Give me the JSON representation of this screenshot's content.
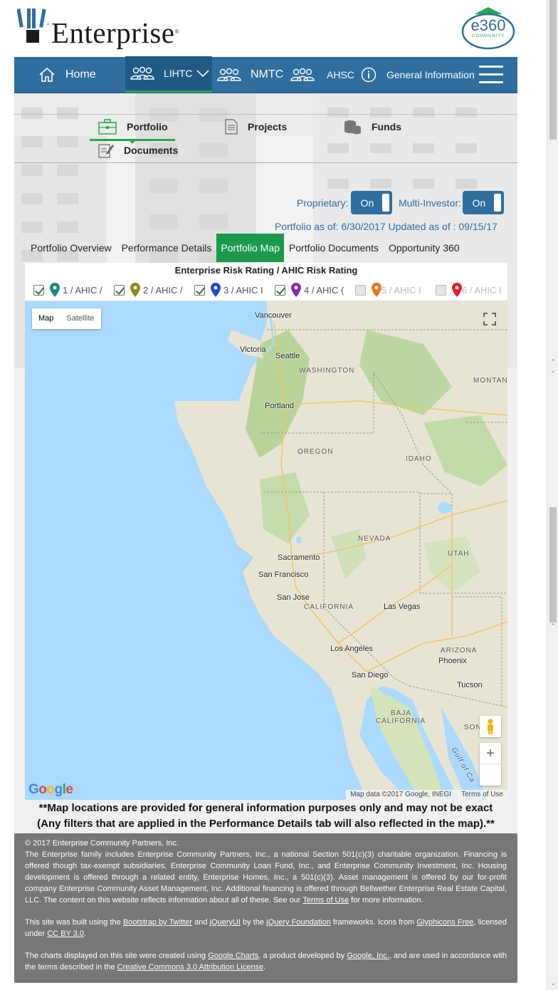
{
  "header": {
    "logo_text": "Enterprise",
    "e360_text": "e360",
    "e360_sub": "COMMUNITY"
  },
  "nav": {
    "items": [
      {
        "label": "Home",
        "icon": "home-icon"
      },
      {
        "label": "LIHTC",
        "icon": "people-icon"
      },
      {
        "label": "NMTC",
        "icon": "people-icon"
      },
      {
        "label": "AHSC",
        "icon": "people-icon"
      },
      {
        "label": "General Information",
        "icon": "info-icon"
      }
    ]
  },
  "subtabs": [
    {
      "label": "Portfolio",
      "icon": "briefcase-icon"
    },
    {
      "label": "Projects",
      "icon": "document-icon"
    },
    {
      "label": "Funds",
      "icon": "coins-icon"
    },
    {
      "label": "Documents",
      "icon": "edit-icon"
    }
  ],
  "toggles": {
    "proprietary_label": "Proprietary:",
    "proprietary_value": "On",
    "multi_label": "Multi-Investor:",
    "multi_value": "On"
  },
  "as_of": "Portfolio as of: 6/30/2017 Updated as of : 09/15/17",
  "main_tabs": [
    "Portfolio Overview",
    "Performance Details",
    "Portfolio Map",
    "Portfolio Documents",
    "Opportunity 360"
  ],
  "map_panel": {
    "title": "Enterprise Risk Rating / AHIC Risk Rating",
    "legend": [
      {
        "label": "1 / AHIC /",
        "color": "#1a8a7a",
        "checked": true
      },
      {
        "label": "2 / AHIC /",
        "color": "#8a8a1a",
        "checked": true
      },
      {
        "label": "3 / AHIC I",
        "color": "#1a4ad0",
        "checked": true
      },
      {
        "label": "4 / AHIC (",
        "color": "#8a2ab0",
        "checked": true
      },
      {
        "label": "5 / AHIC I",
        "color": "#f07020",
        "checked": false
      },
      {
        "label": "6 / AHIC I",
        "color": "#e02020",
        "checked": false
      }
    ],
    "map_type": [
      "Map",
      "Satellite"
    ],
    "attribution": "Map data ©2017 Google, INEGI",
    "terms": "Terms of Use",
    "google": "Google",
    "cities": [
      "Vancouver",
      "Victoria",
      "Seattle",
      "Portland",
      "Sacramento",
      "San Francisco",
      "San Jose",
      "Las Vegas",
      "Los Angeles",
      "San Diego",
      "Phoenix",
      "Tucson"
    ],
    "states": [
      "WASHINGTON",
      "MONTAN",
      "OREGON",
      "IDAHO",
      "NEVADA",
      "UTAH",
      "CALIFORNIA",
      "ARIZONA",
      "BAJA",
      "CALIFORNIA",
      "SON",
      "Gulf of Ca"
    ]
  },
  "note_line1": "**Map locations are provided for general information purposes only and may not be exact",
  "note_line2": "(Any filters that are applied in the Performance Details tab will also reflected in the map).**",
  "footer": {
    "copyright": "© 2017 Enterprise Community Partners, Inc.",
    "p1": "The Enterprise family includes Enterprise Community Partners, Inc., a national Section 501(c)(3) charitable organization. Financing is offered though tax-exempt subsidiaries, Enterprise Community Loan Fund, Inc., and Enterprise Community Investment, Inc. Housing development is offered through a related entity, Enterprise Homes, Inc., a 501(c)(3). Asset management is offered by our for-profit company Enterprise Community Asset Management, Inc. Additional financing is offered through Bellwether Enterprise Real Estate Capital, LLC. The content on this website reflects information about all of these. See our ",
    "p1_link": "Terms of Use",
    "p1_end": " for more information.",
    "p2_a": "This site was built using the ",
    "p2_l1": "Bootstrap by Twitter",
    "p2_b": " and ",
    "p2_l2": "jQueryUI",
    "p2_c": " by the ",
    "p2_l3": "jQuery Foundation",
    "p2_d": " frameworks. Icons from ",
    "p2_l4": "Glyphicons Free",
    "p2_e": ", licensed under ",
    "p2_l5": "CC BY 3.0",
    "p2_f": ".",
    "p3_a": "The charts displayed on this site were created using ",
    "p3_l1": "Google Charts",
    "p3_b": ", a product developed by ",
    "p3_l2": "Google, Inc.",
    "p3_c": ", and are used in accordance with the terms described in the ",
    "p3_l3": "Creative Commons 3.0 Attribution License",
    "p3_d": "."
  }
}
